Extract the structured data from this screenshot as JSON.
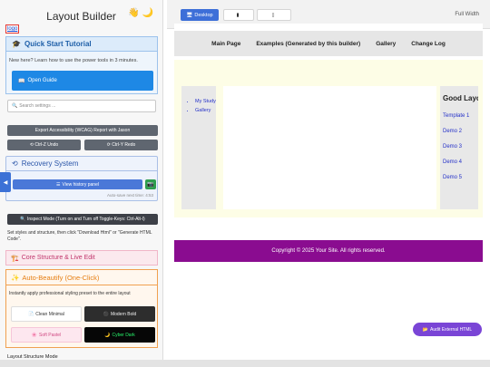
{
  "panel": {
    "logo": "logo",
    "title": "Layout Builder",
    "icons": {
      "hand": "waving-hand-icon",
      "moon": "moon-icon"
    }
  },
  "quick_start": {
    "icon": "graduation-cap-icon",
    "title": "Quick Start Tutorial",
    "description": "New here? Learn how to use the power tools in 3 minutes.",
    "button_icon": "book-icon",
    "button_label": "Open Guide"
  },
  "search": {
    "placeholder": "Search settings ..."
  },
  "actions": {
    "export": "Export Accessibility (WCAG) Report with Jason",
    "undo": "⟲ Ctrl-Z Undo",
    "redo": "⟳ Ctrl-Y Redo"
  },
  "recovery": {
    "icon": "history-icon",
    "title": "Recovery System",
    "history_button": "View history panel",
    "camera_icon": "camera-icon",
    "autosave": "Auto-save next time: 4:53"
  },
  "inspect": {
    "label": "Inspect Mode (Turn on and Turn off Toggle-Keys: Ctrl-Alt-I)"
  },
  "style_note": "Set styles and structure, then click \"Download Html\" or \"Generate HTML Code\".",
  "core": {
    "icon": "construction-icon",
    "title": "Core Structure & Live Edit"
  },
  "beautify": {
    "icon": "sparkles-icon",
    "title": "Auto-Beautify (One-Click)",
    "description": "Instantly apply professional styling preset to the entire layout",
    "presets": {
      "clean": "Clean Minimal",
      "bold": "Modern Bold",
      "pastel": "Soft Pastel",
      "cyber": "Cyber Dark"
    }
  },
  "layout_mode": "Layout Structure Mode",
  "toolbar": {
    "desktop": "Desktop",
    "tablet": "",
    "mobile": "",
    "full_width": "Full Width"
  },
  "preview": {
    "nav": [
      "Main Page",
      "Examples (Generated by this builder)",
      "Gallery",
      "Change Log"
    ],
    "sidebar_links": [
      "My Study",
      "Gallery"
    ],
    "right_heading": "Good Layout Recommendations",
    "demos": [
      "Template 1",
      "Demo 2",
      "Demo 3",
      "Demo 4",
      "Demo 5"
    ],
    "footer": "Copyright © 2025 Your Site. All rights reserved."
  },
  "audit": {
    "label": "Audit External HTML"
  },
  "colors": {
    "accent_blue": "#3d6fd8",
    "footer_purple": "#8a0c90",
    "audit_purple": "#7a45d6",
    "cyber_green": "#27f56b"
  }
}
